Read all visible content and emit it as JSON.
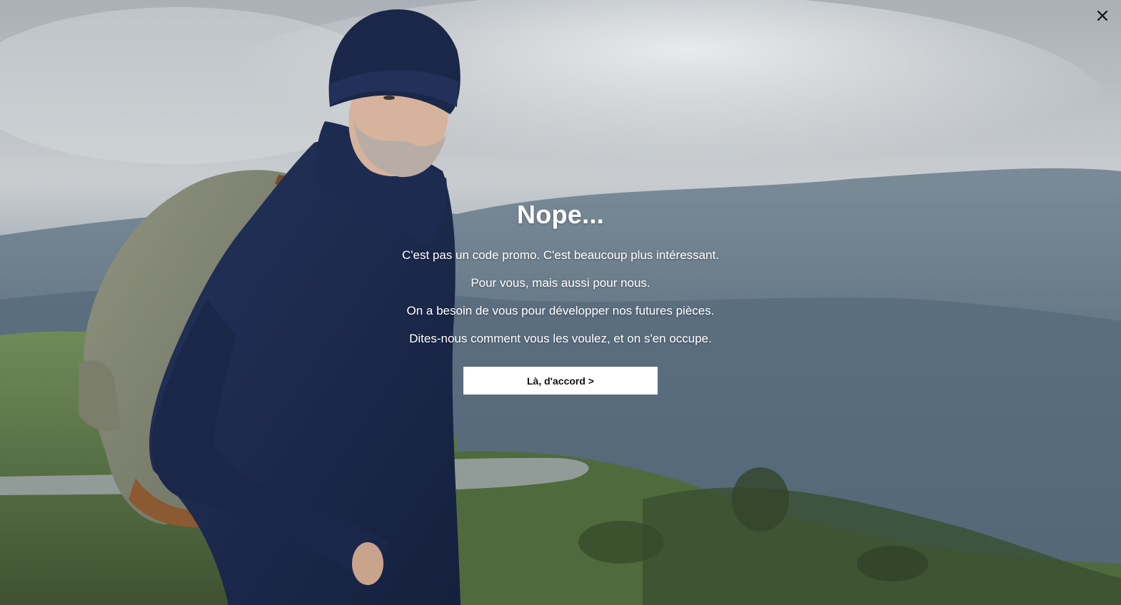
{
  "popup": {
    "title": "Nope...",
    "paragraphs": [
      "C'est pas un code promo. C'est beaucoup plus intéressant.",
      "Pour vous, mais aussi pour nous.",
      "On a besoin de vous pour développer nos futures pièces.",
      "Dites-nous comment vous les voulez, et on s'en occupe."
    ],
    "cta_label": "Là, d'accord >",
    "close_icon": "close-icon"
  },
  "colors": {
    "text": "#ffffff",
    "button_bg": "#ffffff",
    "button_text": "#111111",
    "sweater_navy": "#1c2a4e"
  }
}
